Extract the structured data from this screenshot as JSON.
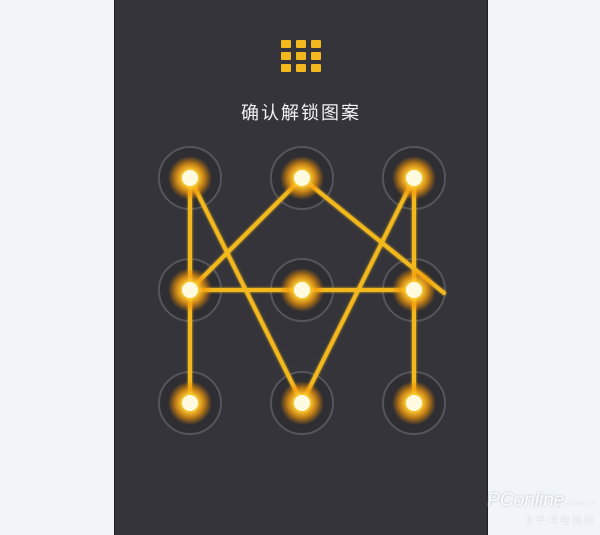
{
  "screen": {
    "title": "确认解锁图案",
    "icon": "grid-dots-icon",
    "accent_color": "#f3b81e",
    "background_color": "#34343a"
  },
  "pattern": {
    "dots": [
      {
        "row": 1,
        "col": 1,
        "active": true
      },
      {
        "row": 1,
        "col": 2,
        "active": true
      },
      {
        "row": 1,
        "col": 3,
        "active": true
      },
      {
        "row": 2,
        "col": 1,
        "active": true
      },
      {
        "row": 2,
        "col": 2,
        "active": true
      },
      {
        "row": 2,
        "col": 3,
        "active": true
      },
      {
        "row": 3,
        "col": 1,
        "active": true
      },
      {
        "row": 3,
        "col": 2,
        "active": true
      },
      {
        "row": 3,
        "col": 3,
        "active": true
      }
    ],
    "sequence": [
      7,
      4,
      1,
      8,
      3,
      9,
      6,
      5,
      4,
      2,
      6
    ]
  },
  "watermark": {
    "brand": "PConline",
    "domain": ".com.cn",
    "subtitle": "太平洋电脑网"
  }
}
